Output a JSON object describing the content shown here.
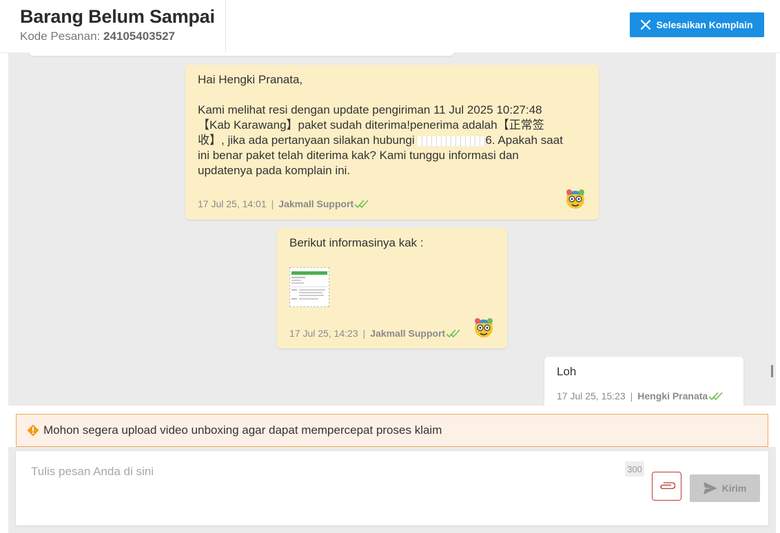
{
  "header": {
    "title": "Barang Belum Sampai",
    "order_label": "Kode Pesanan: ",
    "order_number": "24105403527",
    "close_button_label": "Selesaikan Komplain"
  },
  "messages": [
    {
      "sender": "support",
      "text_lines": [
        "Hai Hengki Pranata,",
        "",
        "Kami melihat resi dengan update pengiriman 11 Jul 2025 10:27:48",
        "【Kab Karawang】paket sudah diterima!penerima adalah【正常签",
        "收】, jika ada pertanyaan silakan hubungi "
      ],
      "text_after_redaction": "6. Apakah saat",
      "text_tail_lines": [
        "ini benar paket telah diterima kak? Kami tunggu informasi dan",
        "updatenya pada komplain ini."
      ],
      "timestamp": "17 Jul 25, 14:01",
      "author": "Jakmall Support"
    },
    {
      "sender": "support",
      "text": "Berikut informasinya kak :",
      "has_attachment": true,
      "timestamp": "17 Jul 25, 14:23",
      "author": "Jakmall Support"
    },
    {
      "sender": "user",
      "text": "Loh",
      "timestamp": "17 Jul 25, 15:23",
      "author": "Hengki Pranata"
    }
  ],
  "warning": {
    "text": "Mohon segera upload video unboxing agar dapat mempercepat proses klaim"
  },
  "composer": {
    "placeholder": "Tulis pesan Anda di sini",
    "char_limit": "300",
    "send_label": "Kirim"
  },
  "colors": {
    "accent": "#1a8fe3",
    "support_bubble": "#fcefc6",
    "read_check": "#6cc04a",
    "warning_border": "#f2a85b",
    "attach_red": "#c0392b"
  }
}
